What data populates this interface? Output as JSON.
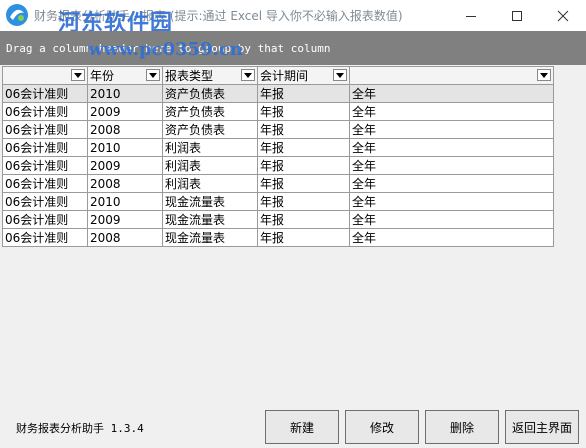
{
  "window": {
    "title": "财务报表分析助手 - 报表 (提示:通过 Excel 导入你不必输入报表数值)",
    "watermark_text": "河东软件园",
    "watermark_url": "www.pc0359.cn"
  },
  "groupbar": {
    "hint": "Drag a column header here to group by that column"
  },
  "grid": {
    "headers": [
      "",
      "年份",
      "报表类型",
      "会计期间",
      ""
    ],
    "rows": [
      [
        "06会计准则",
        "2010",
        "资产负债表",
        "年报",
        "全年"
      ],
      [
        "06会计准则",
        "2009",
        "资产负债表",
        "年报",
        "全年"
      ],
      [
        "06会计准则",
        "2008",
        "资产负债表",
        "年报",
        "全年"
      ],
      [
        "06会计准则",
        "2010",
        "利润表",
        "年报",
        "全年"
      ],
      [
        "06会计准则",
        "2009",
        "利润表",
        "年报",
        "全年"
      ],
      [
        "06会计准则",
        "2008",
        "利润表",
        "年报",
        "全年"
      ],
      [
        "06会计准则",
        "2010",
        "现金流量表",
        "年报",
        "全年"
      ],
      [
        "06会计准则",
        "2009",
        "现金流量表",
        "年报",
        "全年"
      ],
      [
        "06会计准则",
        "2008",
        "现金流量表",
        "年报",
        "全年"
      ]
    ]
  },
  "status": {
    "app_version": "财务报表分析助手 1.3.4"
  },
  "buttons": {
    "new": "新建",
    "edit": "修改",
    "delete": "删除",
    "back": "返回主界面"
  },
  "icons": {
    "app": "app-logo-icon",
    "minimize": "minimize-icon",
    "maximize": "maximize-icon",
    "close": "close-icon",
    "dropdown": "dropdown-arrow-icon"
  },
  "colors": {
    "watermark": "#2f6fd6",
    "groupbar": "#808080",
    "selected_row": "#e4e4e4"
  }
}
